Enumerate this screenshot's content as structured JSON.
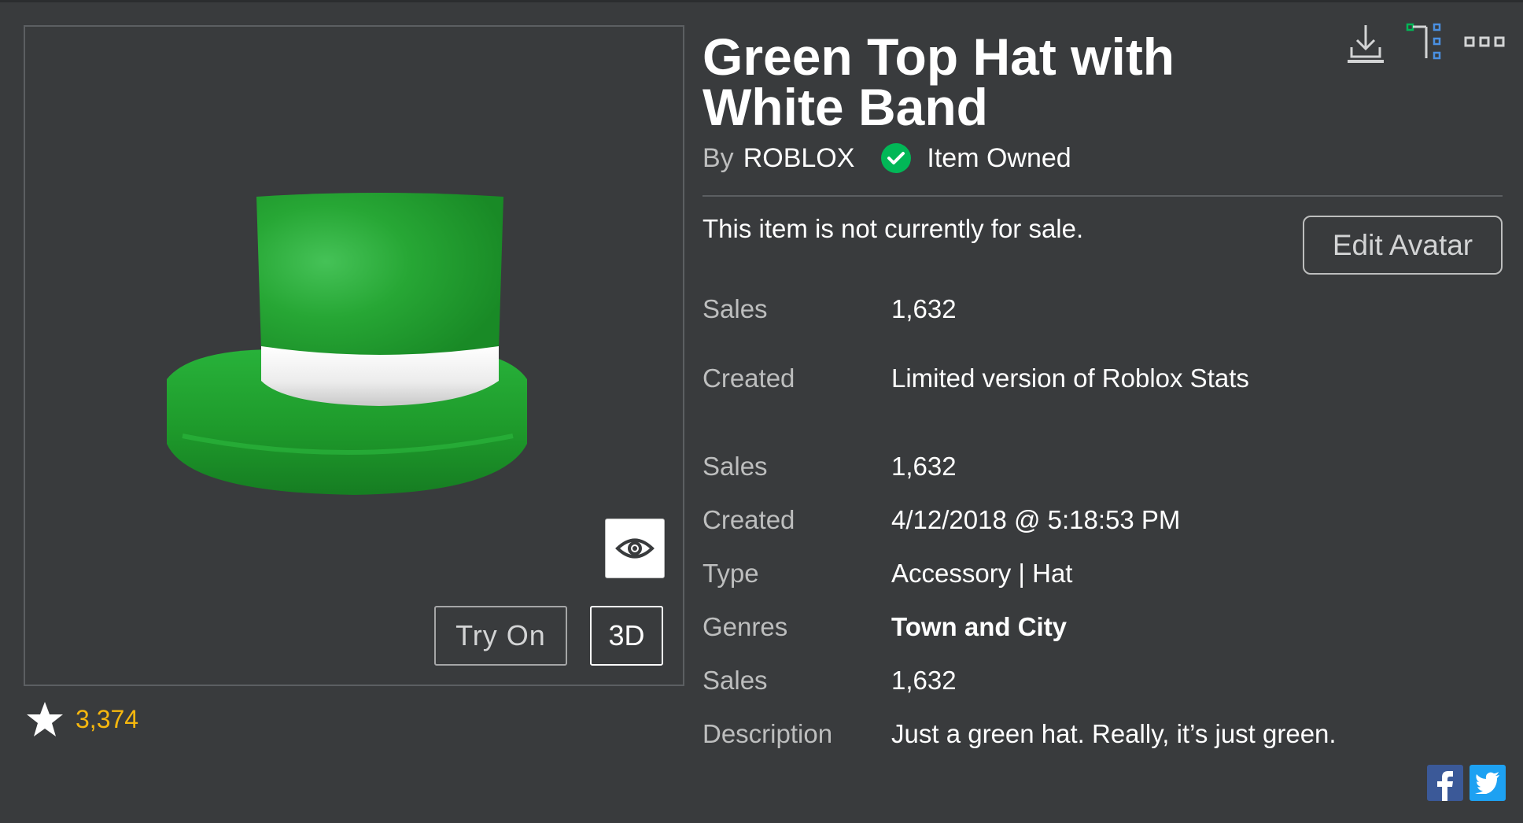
{
  "item": {
    "title": "Green Top Hat with White Band",
    "by_prefix": "By",
    "creator": "ROBLOX",
    "owned_label": "Item Owned",
    "sale_status": "This item is not currently for sale.",
    "favorites": "3,374"
  },
  "thumbnail": {
    "try_on_label": "Try On",
    "three_d_label": "3D",
    "hat_color": "#1f9b2c",
    "band_color": "#f2f2f2"
  },
  "buttons": {
    "edit_avatar_label": "Edit Avatar"
  },
  "details": [
    {
      "label": "Sales",
      "value": "1,632"
    },
    {
      "label": "Created",
      "value": "Limited version of Roblox Stats"
    },
    {
      "label": "Sales",
      "value": "1,632"
    },
    {
      "label": "Created",
      "value": "4/12/2018 @ 5:18:53 PM"
    },
    {
      "label": "Type",
      "value": "Accessory | Hat"
    },
    {
      "label": "Genres",
      "value": "Town and City"
    },
    {
      "label": "Sales",
      "value": "1,632"
    },
    {
      "label": "Description",
      "value": "Just a green hat. Really, it’s just green."
    }
  ],
  "icons": {
    "download": "download-icon",
    "hierarchy": "hierarchy-icon",
    "more": "more-options-icon",
    "eye": "eye-icon",
    "star": "star-icon",
    "check": "check-icon",
    "facebook": "facebook-icon",
    "twitter": "twitter-icon"
  },
  "colors": {
    "background": "#393b3d",
    "owned_green": "#02b757",
    "favorite_gold": "#f6b70e",
    "facebook_blue": "#3b5998",
    "twitter_blue": "#1da1f2"
  }
}
